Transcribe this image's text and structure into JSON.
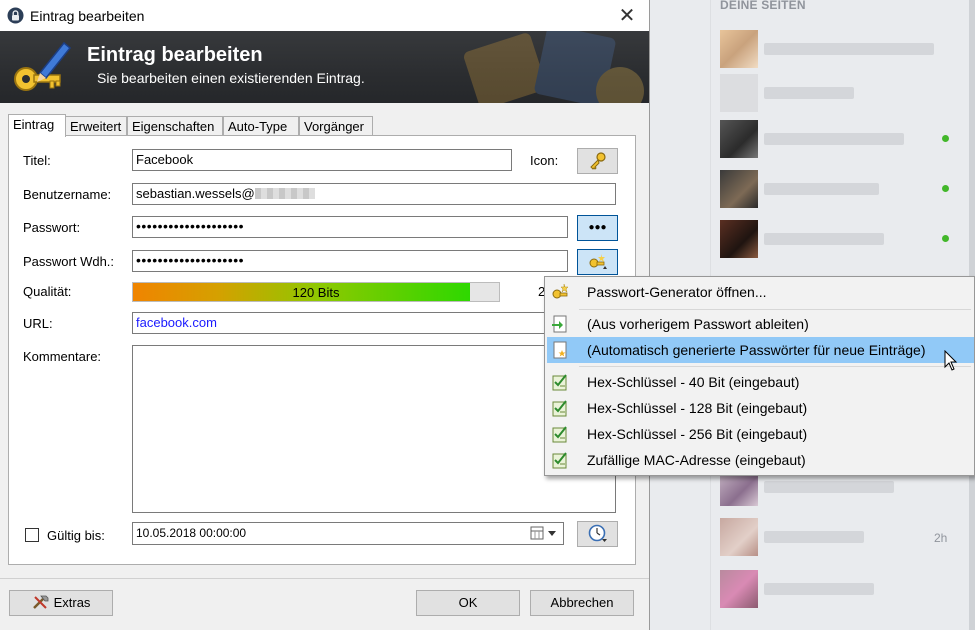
{
  "window": {
    "title": "Eintrag bearbeiten",
    "close_glyph": "✕"
  },
  "banner": {
    "title": "Eintrag bearbeiten",
    "subtitle": "Sie bearbeiten einen existierenden Eintrag."
  },
  "tabs": [
    {
      "label": "Eintrag",
      "active": true
    },
    {
      "label": "Erweitert",
      "active": false
    },
    {
      "label": "Eigenschaften",
      "active": false
    },
    {
      "label": "Auto-Type",
      "active": false
    },
    {
      "label": "Vorgänger",
      "active": false
    }
  ],
  "form": {
    "title_label": "Titel:",
    "title_value": "Facebook",
    "icon_label": "Icon:",
    "username_label": "Benutzername:",
    "username_value": "sebastian.wessels@",
    "password_label": "Passwort:",
    "password_value": "••••••••••••••••••••",
    "password_repeat_label": "Passwort Wdh.:",
    "password_repeat_value": "••••••••••••••••••••",
    "show_password_glyph": "●●●",
    "quality_label": "Qualität:",
    "quality_text": "120 Bits",
    "quality_fraction": 0.92,
    "quality_side_text": "2",
    "url_label": "URL:",
    "url_value": "facebook.com",
    "notes_label": "Kommentare:",
    "notes_value": "",
    "expires_label": "Gültig bis:",
    "expires_checked": false,
    "expires_value": "10.05.2018 00:00:00"
  },
  "footer": {
    "extras_label": "Extras",
    "ok_label": "OK",
    "cancel_label": "Abbrechen"
  },
  "generator_menu": {
    "items": [
      {
        "label": "Passwort-Generator öffnen...",
        "icon": "key-wand-icon",
        "hover": false
      },
      {
        "label": "(Aus vorherigem Passwort ableiten)",
        "icon": "derive-icon",
        "hover": false
      },
      {
        "label": "(Automatisch generierte Passwörter für neue Einträge)",
        "icon": "auto-generate-icon",
        "hover": true
      },
      {
        "label": "Hex-Schlüssel - 40 Bit (eingebaut)",
        "icon": "checklist-icon",
        "hover": false
      },
      {
        "label": "Hex-Schlüssel - 128 Bit (eingebaut)",
        "icon": "checklist-icon",
        "hover": false
      },
      {
        "label": "Hex-Schlüssel - 256 Bit (eingebaut)",
        "icon": "checklist-icon",
        "hover": false
      },
      {
        "label": "Zufällige MAC-Adresse (eingebaut)",
        "icon": "checklist-icon",
        "hover": false
      }
    ]
  },
  "background_page": {
    "heading": "DEINE SEITEN",
    "contact_time": "2h"
  },
  "colors": {
    "banner_dark": "#2b2d30",
    "menu_hover": "#91c9f7",
    "link": "#1a1aff",
    "online_green": "#42b72a"
  }
}
